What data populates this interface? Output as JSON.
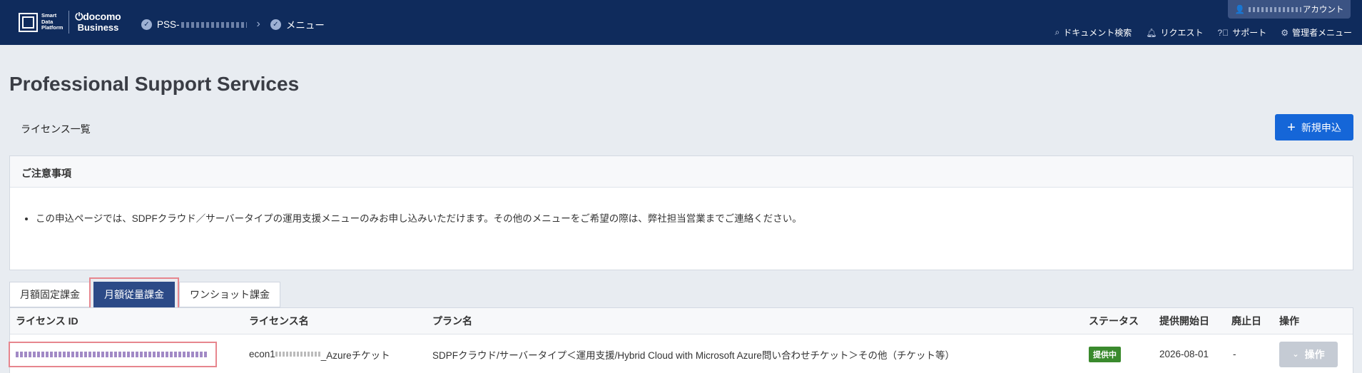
{
  "header": {
    "brand_sdp": "Smart\nData\nPlatform",
    "brand_docomo_top": "docomo",
    "brand_docomo_bottom": "Business",
    "breadcrumb": [
      {
        "label": "PSS-"
      },
      {
        "label": "メニュー"
      }
    ],
    "account_suffix": "アカウント",
    "nav": [
      {
        "icon": "search-icon",
        "label": "ドキュメント検索"
      },
      {
        "icon": "bell-icon",
        "label": "リクエスト"
      },
      {
        "icon": "help-icon",
        "label": "サポート"
      },
      {
        "icon": "gear-icon",
        "label": "管理者メニュー"
      }
    ]
  },
  "page": {
    "title": "Professional Support Services",
    "section_label": "ライセンス一覧",
    "new_button_label": "新規申込"
  },
  "notice": {
    "heading": "ご注意事項",
    "items": [
      "この申込ページでは、SDPFクラウド／サーバータイプの運用支援メニューのみお申し込みいただけます。その他のメニューをご希望の際は、弊社担当営業までご連絡ください。"
    ]
  },
  "tabs": [
    {
      "label": "月額固定課金",
      "active": false
    },
    {
      "label": "月額従量課金",
      "active": true
    },
    {
      "label": "ワンショット課金",
      "active": false
    }
  ],
  "table": {
    "headers": [
      "ライセンス ID",
      "ライセンス名",
      "プラン名",
      "ステータス",
      "提供開始日",
      "廃止日",
      "操作"
    ],
    "rows": [
      {
        "license_name_prefix": "econ1",
        "license_name_suffix": "_Azureチケット",
        "plan": "SDPFクラウド/サーバータイプ＜運用支援/Hybrid Cloud with Microsoft Azure問い合わせチケット＞その他（チケット等）",
        "status": "提供中",
        "start_date": "2026-08-01",
        "end_date": "-",
        "action_label": "操作"
      }
    ]
  },
  "colors": {
    "header_bg": "#0f2b5c",
    "primary": "#1566d8",
    "active_tab": "#2c4a87",
    "status_green": "#3a8a2d",
    "highlight": "#e7868e"
  }
}
